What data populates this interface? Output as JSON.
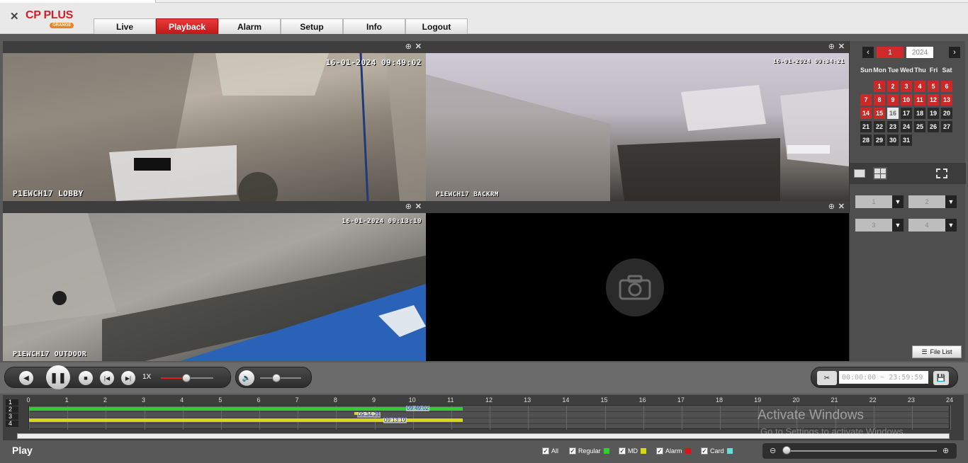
{
  "brand": {
    "name": "CP PLUS",
    "sub": "ORANGE"
  },
  "nav": [
    {
      "label": "Live",
      "active": false
    },
    {
      "label": "Playback",
      "active": true
    },
    {
      "label": "Alarm",
      "active": false
    },
    {
      "label": "Setup",
      "active": false
    },
    {
      "label": "Info",
      "active": false
    },
    {
      "label": "Logout",
      "active": false
    }
  ],
  "panes": [
    {
      "timestamp": "16-01-2024 09:49:02",
      "channel": "P1EWCH17 LOBBY"
    },
    {
      "timestamp": "16-01-2024 09:34:21",
      "channel": "P1EWCH17 BACKRM"
    },
    {
      "timestamp": "16-01-2024 09:13:19",
      "channel": "P1EWCH17 OUTDOOR"
    },
    {
      "timestamp": "",
      "channel": ""
    }
  ],
  "calendar": {
    "month": "1",
    "year": "2024",
    "dows": [
      "Sun",
      "Mon",
      "Tue",
      "Wed",
      "Thu",
      "Fri",
      "Sat"
    ],
    "first_weekday": 1,
    "days": 31,
    "recorded_days": [
      1,
      2,
      3,
      4,
      5,
      6,
      7,
      8,
      9,
      10,
      11,
      12,
      13,
      14,
      15
    ],
    "today": 16
  },
  "channel_selects": [
    "1",
    "2",
    "3",
    "4"
  ],
  "file_list_label": "File List",
  "speed_label": "1X",
  "speed_level": 0.48,
  "volume_level": 0.4,
  "clip_time": "00:00:00 ~ 23:59:59",
  "timeline": {
    "rows": [
      "1",
      "2",
      "3",
      "4"
    ],
    "hours": [
      "0",
      "1",
      "2",
      "3",
      "4",
      "5",
      "6",
      "7",
      "8",
      "9",
      "10",
      "11",
      "12",
      "13",
      "14",
      "15",
      "16",
      "17",
      "18",
      "19",
      "20",
      "21",
      "22",
      "23",
      "24"
    ],
    "markers": [
      "09:49:02",
      "09:34:21",
      "09:13:19"
    ],
    "colors": {
      "regular": "#33cc33",
      "md": "#d8d818",
      "alarm": "#dd1111",
      "card": "#66dddd"
    }
  },
  "watermark": {
    "line1": "Activate Windows",
    "line2": "Go to Settings to activate Windows."
  },
  "status": "Play",
  "legend": {
    "all": "All",
    "regular": "Regular",
    "md": "MD",
    "alarm": "Alarm",
    "card": "Card"
  }
}
